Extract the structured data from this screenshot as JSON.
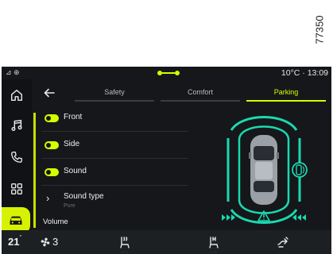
{
  "reference_id": "77350",
  "status_bar": {
    "temperature": "10°C",
    "separator": "·",
    "time": "13:09"
  },
  "nav_rail": {
    "items": [
      "home-icon",
      "music-icon",
      "phone-icon",
      "apps-grid-icon",
      "car-icon"
    ],
    "active": "car-icon",
    "accent_color": "#d7f200"
  },
  "tabs": [
    {
      "label": "Safety",
      "active": false
    },
    {
      "label": "Comfort",
      "active": false
    },
    {
      "label": "Parking",
      "active": true
    }
  ],
  "settings": {
    "front": {
      "label": "Front",
      "enabled": true
    },
    "side": {
      "label": "Side",
      "enabled": true
    },
    "sound": {
      "label": "Sound",
      "enabled": true
    },
    "sound_type": {
      "label": "Sound type",
      "value": "Pure"
    },
    "volume": {
      "label": "Volume"
    }
  },
  "parking_view": {
    "sensor_color": "#1ad9b0",
    "icons": [
      "car-top-view-icon",
      "side-sensor-icon",
      "warning-icon",
      "arrows-right-icon",
      "arrows-left-icon"
    ]
  },
  "climate": {
    "temperature": "21",
    "temperature_unit": "°",
    "fan_level": "3"
  },
  "colors": {
    "accent": "#d4ff00",
    "background": "#15171a",
    "sensor": "#1ad9b0"
  }
}
